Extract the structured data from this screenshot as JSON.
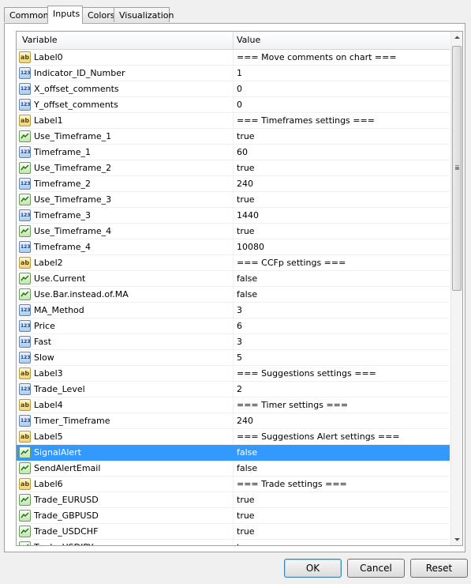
{
  "tabs": [
    "Common",
    "Inputs",
    "Colors",
    "Visualization"
  ],
  "active_tab": "Inputs",
  "columns": {
    "variable": "Variable",
    "value": "Value"
  },
  "rows": [
    {
      "type": "string",
      "name": "Label0",
      "value": "=== Move comments on chart ==="
    },
    {
      "type": "int",
      "name": "Indicator_ID_Number",
      "value": "1"
    },
    {
      "type": "int",
      "name": "X_offset_comments",
      "value": "0"
    },
    {
      "type": "int",
      "name": "Y_offset_comments",
      "value": "0"
    },
    {
      "type": "string",
      "name": "Label1",
      "value": "=== Timeframes settings ==="
    },
    {
      "type": "bool",
      "name": "Use_Timeframe_1",
      "value": "true"
    },
    {
      "type": "int",
      "name": "Timeframe_1",
      "value": "60"
    },
    {
      "type": "bool",
      "name": "Use_Timeframe_2",
      "value": "true"
    },
    {
      "type": "int",
      "name": "Timeframe_2",
      "value": "240"
    },
    {
      "type": "bool",
      "name": "Use_Timeframe_3",
      "value": "true"
    },
    {
      "type": "int",
      "name": "Timeframe_3",
      "value": "1440"
    },
    {
      "type": "bool",
      "name": "Use_Timeframe_4",
      "value": "true"
    },
    {
      "type": "int",
      "name": "Timeframe_4",
      "value": "10080"
    },
    {
      "type": "string",
      "name": "Label2",
      "value": "=== CCFp settings ==="
    },
    {
      "type": "bool",
      "name": "Use.Current",
      "value": "false"
    },
    {
      "type": "bool",
      "name": "Use.Bar.instead.of.MA",
      "value": "false"
    },
    {
      "type": "int",
      "name": "MA_Method",
      "value": "3"
    },
    {
      "type": "int",
      "name": "Price",
      "value": "6"
    },
    {
      "type": "int",
      "name": "Fast",
      "value": "3"
    },
    {
      "type": "int",
      "name": "Slow",
      "value": "5"
    },
    {
      "type": "string",
      "name": "Label3",
      "value": "=== Suggestions settings ==="
    },
    {
      "type": "int",
      "name": "Trade_Level",
      "value": "2"
    },
    {
      "type": "string",
      "name": "Label4",
      "value": "=== Timer settings ==="
    },
    {
      "type": "int",
      "name": "Timer_Timeframe",
      "value": "240"
    },
    {
      "type": "string",
      "name": "Label5",
      "value": "=== Suggestions Alert settings ==="
    },
    {
      "type": "bool",
      "name": "SignalAlert",
      "value": "false",
      "selected": true
    },
    {
      "type": "bool",
      "name": "SendAlertEmail",
      "value": "false"
    },
    {
      "type": "string",
      "name": "Label6",
      "value": "=== Trade settings ==="
    },
    {
      "type": "bool",
      "name": "Trade_EURUSD",
      "value": "true"
    },
    {
      "type": "bool",
      "name": "Trade_GBPUSD",
      "value": "true"
    },
    {
      "type": "bool",
      "name": "Trade_USDCHF",
      "value": "true"
    },
    {
      "type": "bool",
      "name": "Trade_USDJPY",
      "value": "true"
    }
  ],
  "icons": {
    "string": "ab",
    "int": "123"
  },
  "buttons": {
    "ok": "OK",
    "cancel": "Cancel",
    "reset": "Reset"
  },
  "colors": {
    "selection": "#3399ff"
  }
}
